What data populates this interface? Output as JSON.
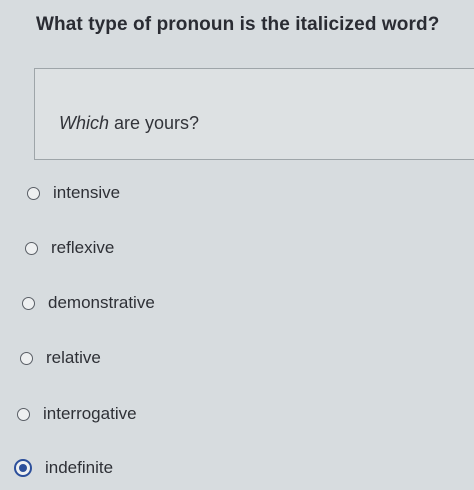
{
  "question": {
    "title": "What type of pronoun is the italicized word?"
  },
  "sentence": {
    "italic_word": "Which",
    "rest": " are yours?"
  },
  "options": [
    {
      "label": "intensive",
      "selected": false
    },
    {
      "label": "reflexive",
      "selected": false
    },
    {
      "label": "demonstrative",
      "selected": false
    },
    {
      "label": "relative",
      "selected": false
    },
    {
      "label": "interrogative",
      "selected": false
    },
    {
      "label": "indefinite",
      "selected": true
    }
  ],
  "colors": {
    "background": "#d7dcdf",
    "selected_radio": "#2c4f9b",
    "text": "#2b2d33"
  }
}
